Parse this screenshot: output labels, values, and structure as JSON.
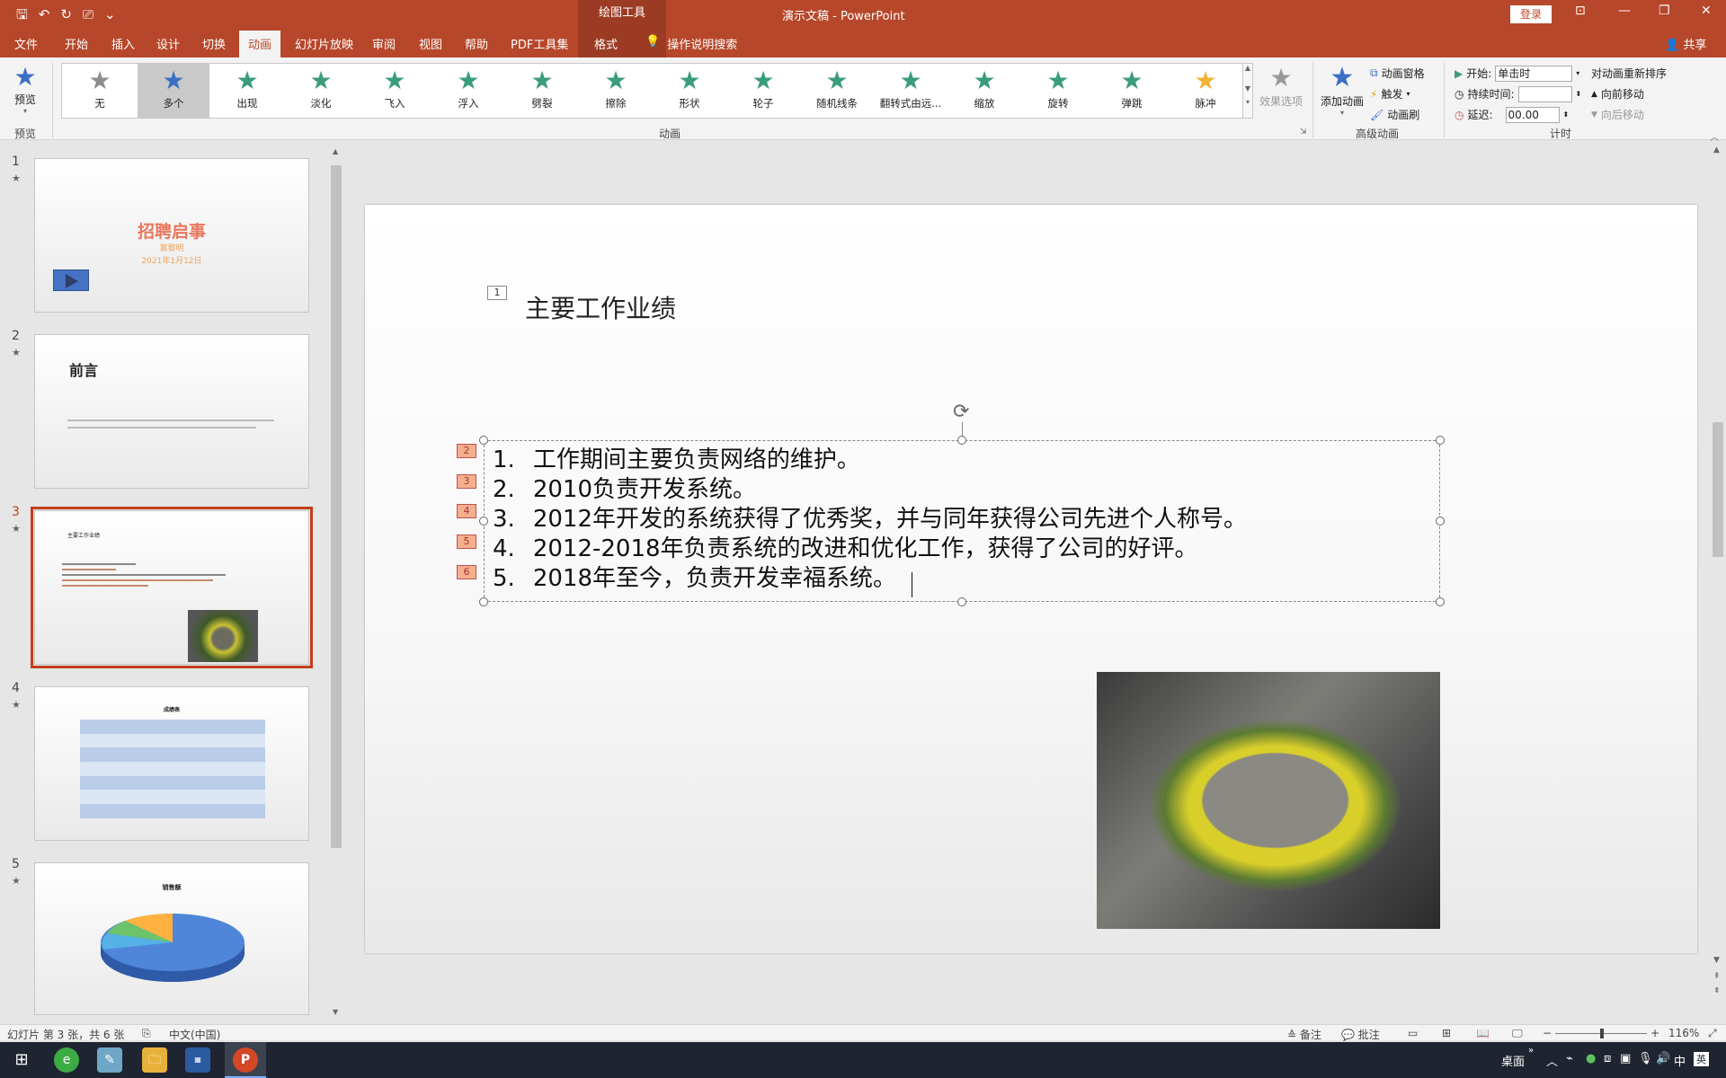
{
  "window": {
    "title": "演示文稿 - PowerPoint",
    "context_tool": "绘图工具",
    "login": "登录",
    "share": "共享"
  },
  "tabs": {
    "file": "文件",
    "home": "开始",
    "insert": "插入",
    "design": "设计",
    "transitions": "切换",
    "animations": "动画",
    "slideshow": "幻灯片放映",
    "review": "审阅",
    "view": "视图",
    "help": "帮助",
    "pdf": "PDF工具集",
    "format": "格式",
    "tell_me": "操作说明搜索"
  },
  "ribbon": {
    "preview": "预览",
    "preview_group": "预览",
    "animation_group": "动画",
    "advanced_group": "高级动画",
    "timing_group": "计时",
    "effects": [
      "无",
      "多个",
      "出现",
      "淡化",
      "飞入",
      "浮入",
      "劈裂",
      "擦除",
      "形状",
      "轮子",
      "随机线条",
      "翻转式由远...",
      "缩放",
      "旋转",
      "弹跳",
      "脉冲"
    ],
    "effect_options": "效果选项",
    "add_animation": "添加动画",
    "animation_pane": "动画窗格",
    "trigger": "触发",
    "animation_painter": "动画刷",
    "start_label": "开始:",
    "start_value": "单击时",
    "duration_label": "持续时间:",
    "duration_value": "",
    "delay_label": "延迟:",
    "delay_value": "00.00",
    "reorder_title": "对动画重新排序",
    "move_earlier": "向前移动",
    "move_later": "向后移动"
  },
  "thumbnails": {
    "numbers": [
      "1",
      "2",
      "3",
      "4",
      "5"
    ],
    "slide1_title": "招聘启事",
    "slide1_sub": "富黎明",
    "slide1_date": "2021年1月12日",
    "slide2_title": "前言",
    "slide3_title": "主要工作业绩",
    "slide4_title": "成绩表",
    "slide5_title": "销售额"
  },
  "slide": {
    "title_tag": "1",
    "title": "主要工作业绩",
    "tags": [
      "2",
      "3",
      "4",
      "5",
      "6"
    ],
    "bullets": [
      {
        "num": "1.",
        "text": "工作期间主要负责网络的维护。"
      },
      {
        "num": "2.",
        "text": "2010负责开发系统。"
      },
      {
        "num": "3.",
        "text": "2012年开发的系统获得了优秀奖，并与同年获得公司先进个人称号。"
      },
      {
        "num": "4.",
        "text": "2012-2018年负责系统的改进和优化工作，获得了公司的好评。"
      },
      {
        "num": "5.",
        "text": "2018年至今，负责开发幸福系统。"
      }
    ]
  },
  "status": {
    "slide_info": "幻灯片 第 3 张，共 6 张",
    "language": "中文(中国)",
    "notes": "备注",
    "comments": "批注",
    "zoom": "116%"
  },
  "taskbar": {
    "desktop": "桌面",
    "ime": "中",
    "ime2": "英"
  },
  "colors": {
    "accent": "#b7472a",
    "selection": "#c43e1c",
    "star_green": "#3b9c7a",
    "star_blue": "#3a6fc4",
    "star_gray": "#8c8c8c",
    "star_gold": "#f2b233"
  }
}
